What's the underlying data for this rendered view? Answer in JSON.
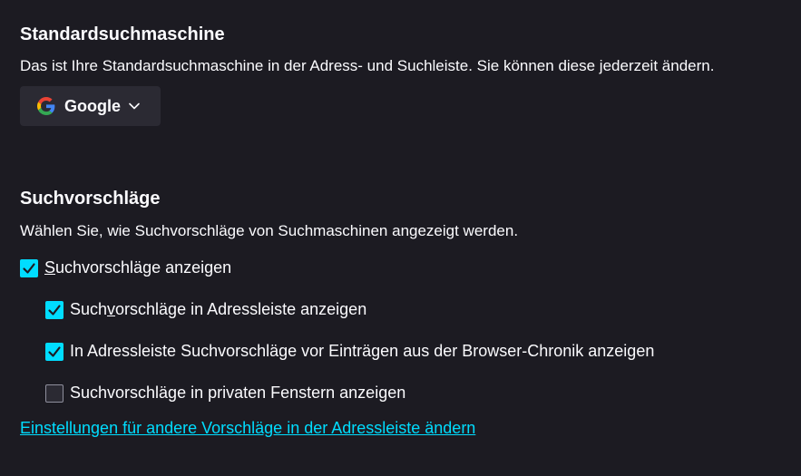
{
  "default_engine": {
    "heading": "Standardsuchmaschine",
    "description": "Das ist Ihre Standardsuchmaschine in der Adress- und Suchleiste. Sie können diese jederzeit ändern.",
    "selected": "Google",
    "icon": "google-logo-icon"
  },
  "suggestions": {
    "heading": "Suchvorschläge",
    "description": "Wählen Sie, wie Suchvorschläge von Suchmaschinen angezeigt werden.",
    "options": [
      {
        "pre": "",
        "key": "S",
        "post": "uchvorschläge anzeigen",
        "checked": true
      },
      {
        "pre": "Such",
        "key": "v",
        "post": "orschläge in Adressleiste anzeigen",
        "checked": true
      },
      {
        "pre": "In Adressleiste Suchvorschläge vor Einträgen aus der Browser-Chronik anzeigen",
        "key": "",
        "post": "",
        "checked": true
      },
      {
        "pre": "Suchvorschläge in privaten Fenstern anzeigen",
        "key": "",
        "post": "",
        "checked": false
      }
    ],
    "link": "Einstellungen für andere Vorschläge in der Adressleiste ändern"
  },
  "colors": {
    "background": "#1c1b22",
    "accent": "#00ddff",
    "control": "#2b2a33"
  }
}
